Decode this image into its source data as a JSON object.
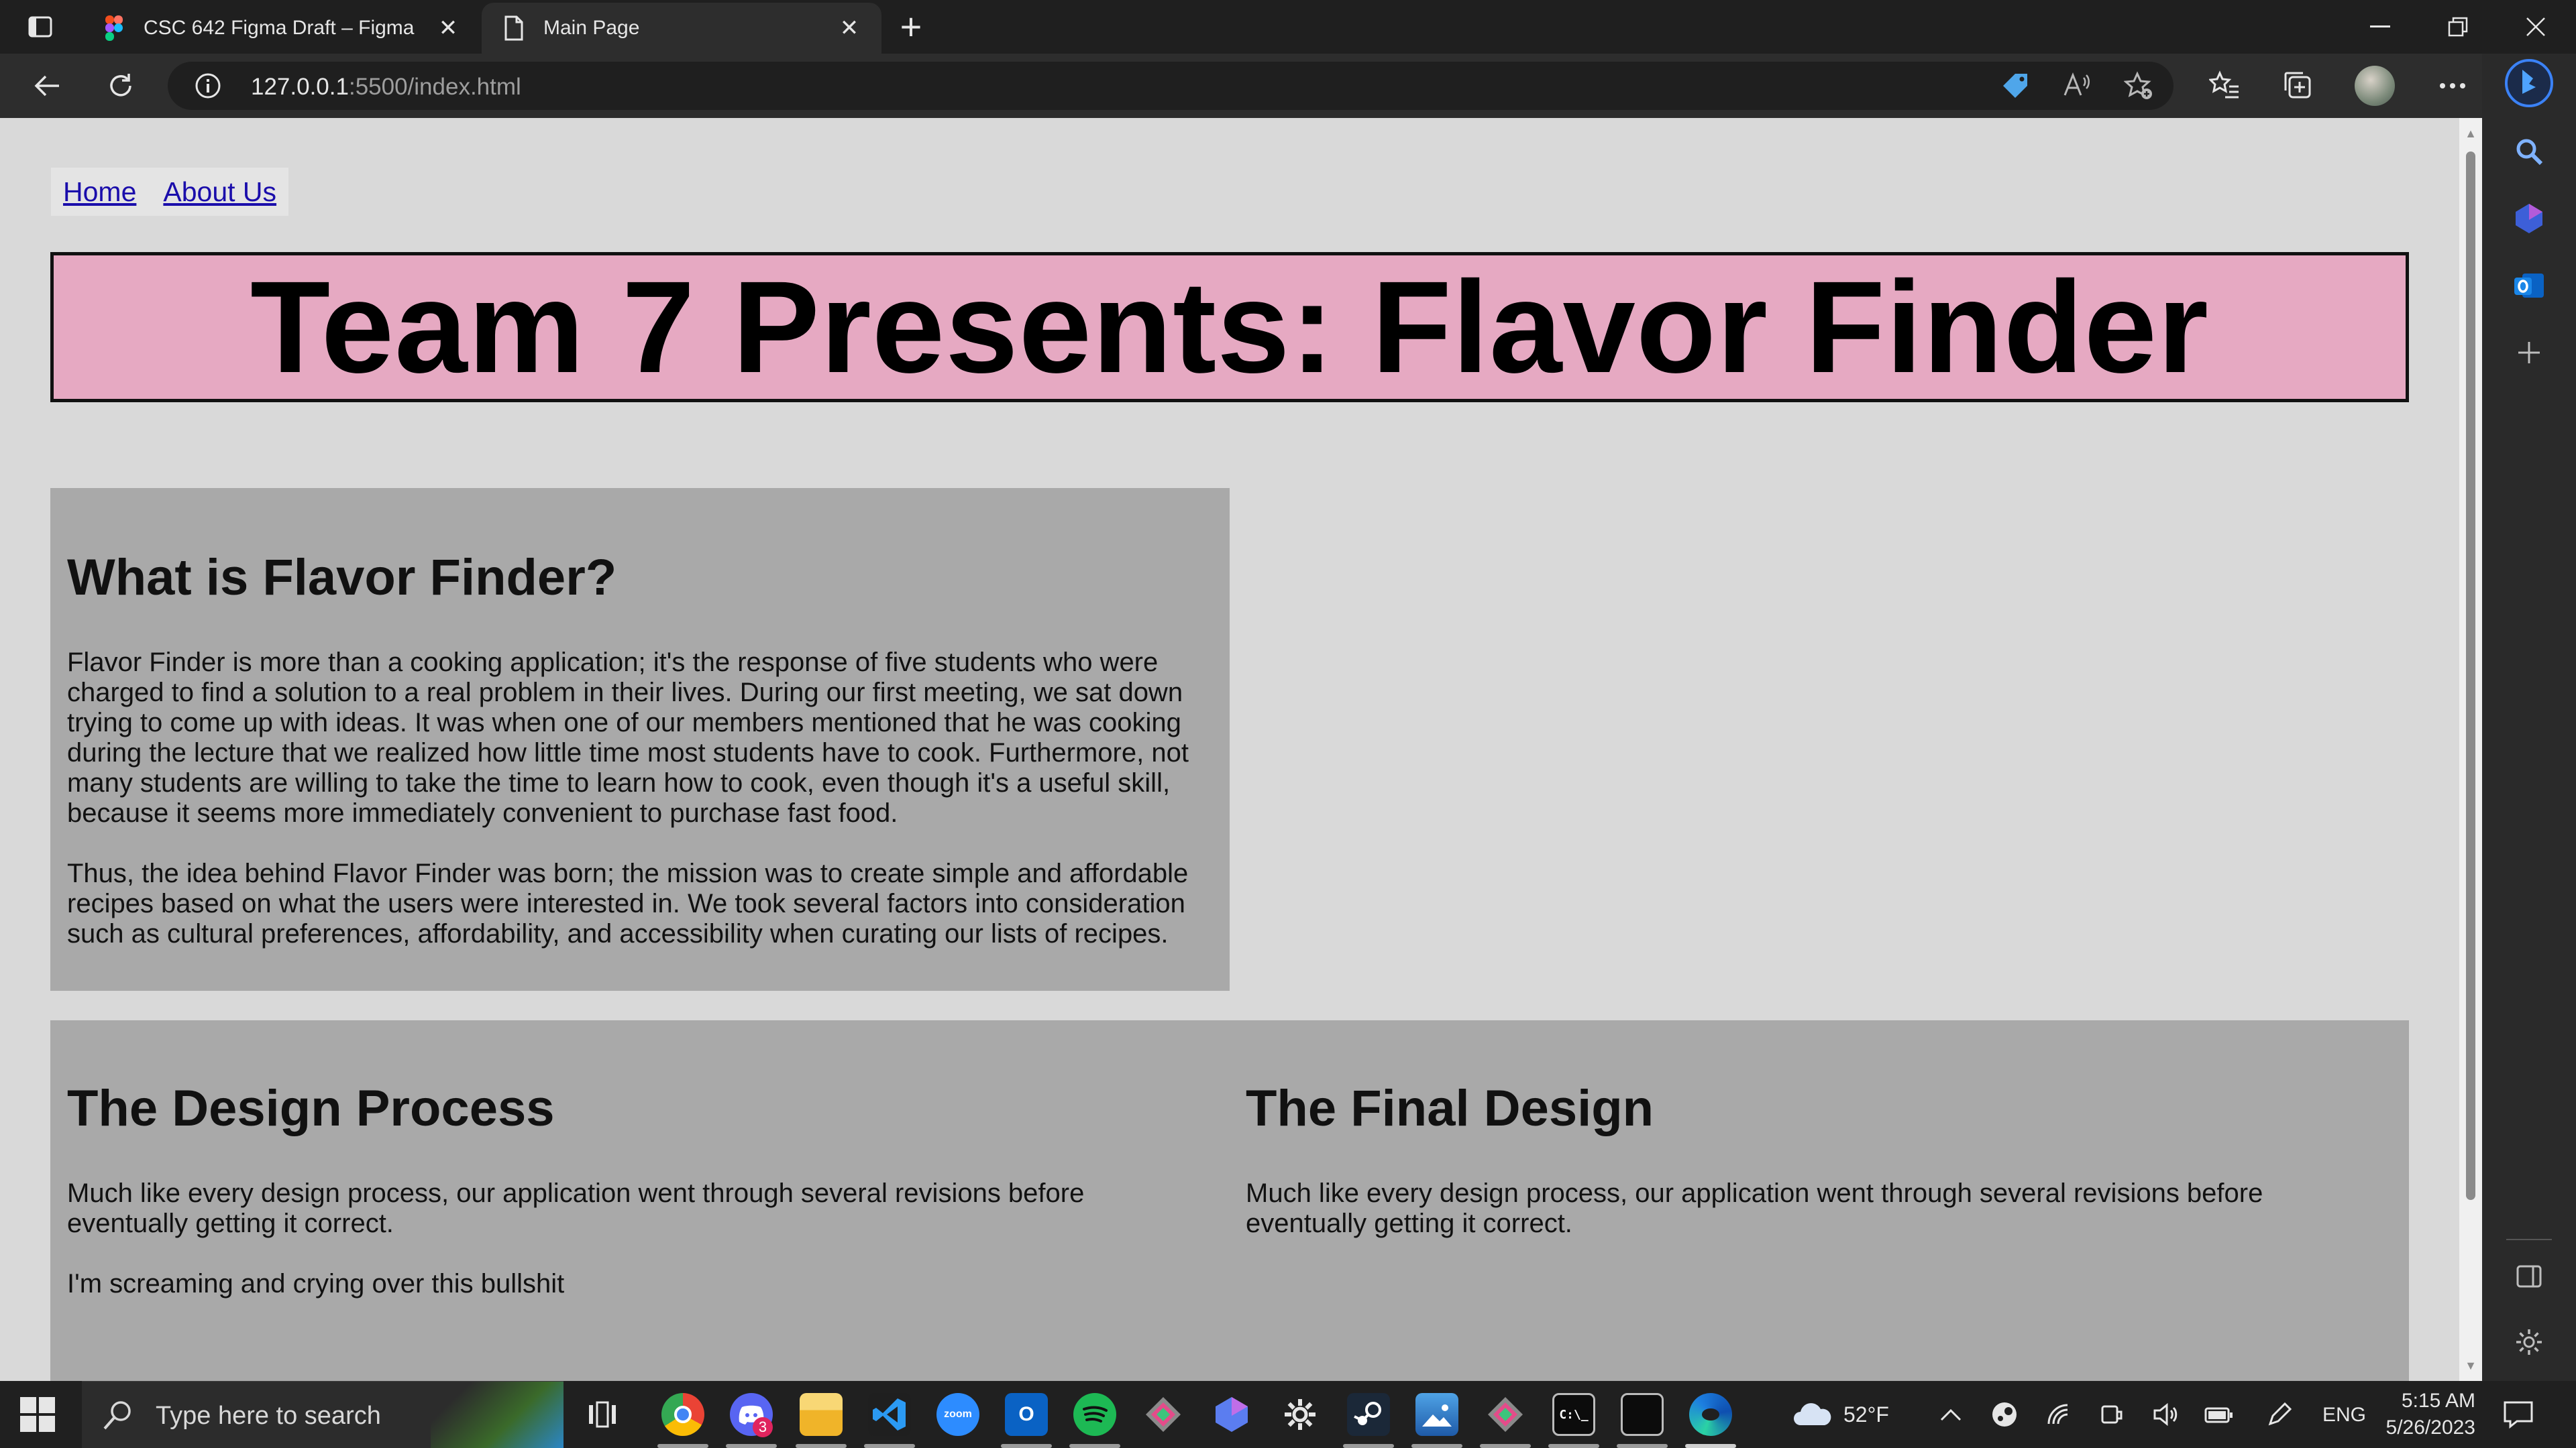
{
  "browser": {
    "tabs": [
      {
        "title": "CSC 642 Figma Draft – Figma",
        "icon": "figma-icon",
        "active": false
      },
      {
        "title": "Main Page",
        "icon": "page-icon",
        "active": true
      }
    ],
    "url_host": "127.0.0.1",
    "url_rest": ":5500/index.html"
  },
  "page": {
    "nav": {
      "home": "Home",
      "about": "About Us"
    },
    "banner_title": "Team 7 Presents: Flavor Finder",
    "about": {
      "heading": "What is Flavor Finder?",
      "paragraphs": [
        "Flavor Finder is more than a cooking application; it's the response of five students who were charged to find a solution to a real problem in their lives. During our first meeting, we sat down trying to come up with ideas. It was when one of our members mentioned that he was cooking during the lecture that we realized how little time most students have to cook. Furthermore, not many students are willing to take the time to learn how to cook, even though it's a useful skill, because it seems more immediately convenient to purchase fast food.",
        "Thus, the idea behind Flavor Finder was born; the mission was to create simple and affordable recipes based on what the users were interested in. We took several factors into consideration such as cultural preferences, affordability, and accessibility when curating our lists of recipes."
      ]
    },
    "design_process": {
      "heading": "The Design Process",
      "paragraphs": [
        "Much like every design process, our application went through several revisions before eventually getting it correct.",
        "I'm screaming and crying over this bullshit"
      ]
    },
    "final_design": {
      "heading": "The Final Design",
      "paragraphs": [
        "Much like every design process, our application went through several revisions before eventually getting it correct."
      ]
    }
  },
  "taskbar": {
    "search_placeholder": "Type here to search",
    "weather": "52°F",
    "language": "ENG",
    "time": "5:15 AM",
    "date": "5/26/2023",
    "notification_badge": "3"
  },
  "colors": {
    "banner_bg": "#e6a9c2",
    "card_bg": "#a9a9a9",
    "page_bg": "#d9d9d9",
    "link": "#1a0dab"
  }
}
